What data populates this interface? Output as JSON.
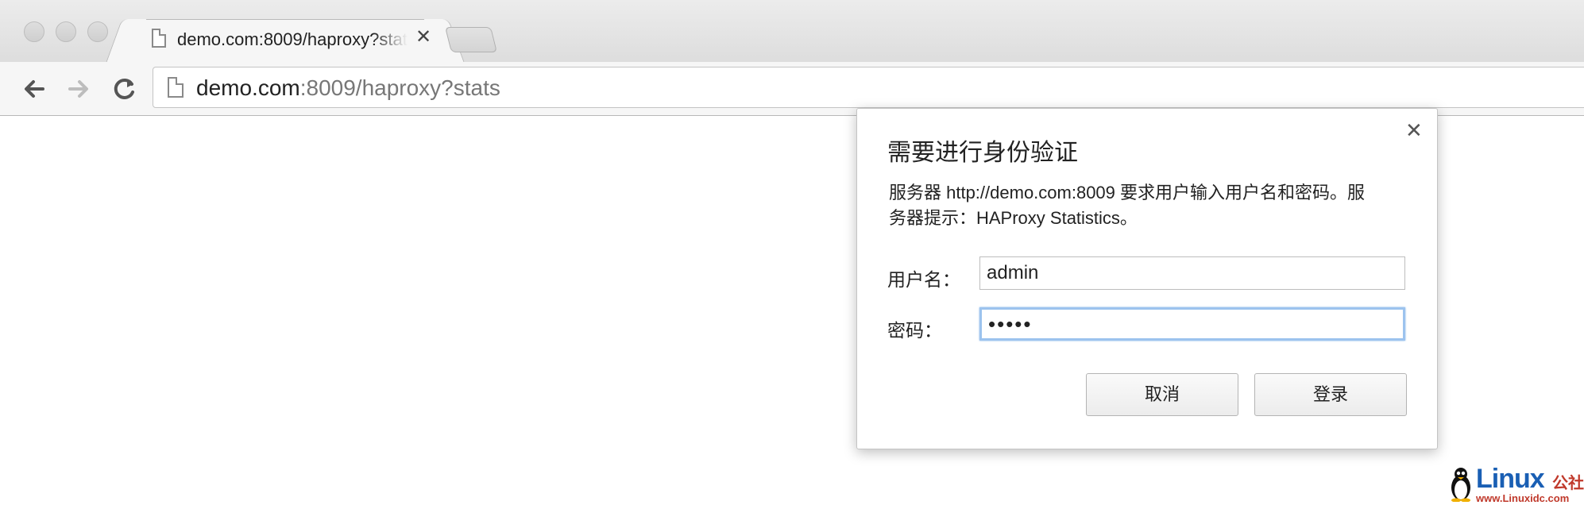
{
  "browser": {
    "tab": {
      "title": "demo.com:8009/haproxy?stats",
      "close_glyph": "✕"
    },
    "nav": {
      "back_glyph": "🡐",
      "forward_glyph": "🡒",
      "reload_glyph": "↻"
    },
    "address_bar": {
      "host": "demo.com",
      "rest": ":8009/haproxy?stats"
    }
  },
  "auth_dialog": {
    "title": "需要进行身份验证",
    "message": "服务器 http://demo.com:8009 要求用户输入用户名和密码。服务器提示：HAProxy Statistics。",
    "close_glyph": "✕",
    "username_label": "用户名：",
    "username_value": "admin",
    "password_label": "密码：",
    "password_value": "•••••",
    "cancel_label": "取消",
    "login_label": "登录"
  },
  "watermark": {
    "brand": "Linux",
    "suffix": "公社",
    "url": "www.Linuxidc.com"
  }
}
